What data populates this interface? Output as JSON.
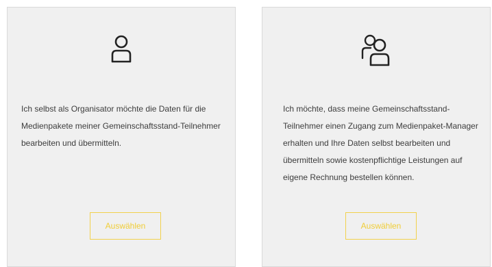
{
  "cards": [
    {
      "icon": "single-user-icon",
      "description": "Ich selbst als Organisator möchte die Daten für die Medienpakete meiner Gemeinschaftsstand-Teilnehmer bearbeiten und übermitteln.",
      "button_label": "Auswählen"
    },
    {
      "icon": "two-users-icon",
      "description": "Ich möchte, dass meine Gemeinschaftsstand-Teilnehmer einen Zugang zum Medienpaket-Manager erhalten und Ihre Daten selbst bearbeiten und übermitteln sowie kostenpflichtige Leistungen auf eigene Rechnung bestellen können.",
      "button_label": "Auswählen"
    }
  ],
  "colors": {
    "card_background": "#f0f0f0",
    "accent_yellow": "#f0cd36",
    "text": "#3c3c3c"
  }
}
